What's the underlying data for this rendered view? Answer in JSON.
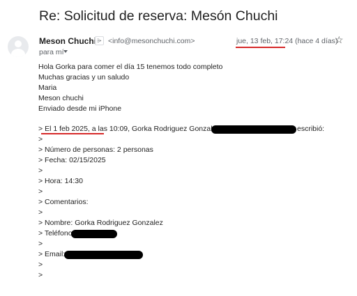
{
  "email": {
    "subject": "Re: Solicitud de reserva: Mesón Chuchi",
    "sender_name": "Meson Chuchi",
    "sender_email": "<info@mesonchuchi.com>",
    "to_me": "para mí",
    "date": "jue, 13 feb, 17:24",
    "relative_date": " (hace 4 días)",
    "body_lines": [
      "Hola Gorka para comer el día 15 tenemos todo completo",
      "Muchas gracias y un saludo",
      "Maria",
      "Meson chuchi",
      "Enviado desde mi iPhone"
    ],
    "quote": {
      "prefix": "> ",
      "date_text": "El 1 feb 2025, a las 10:09",
      "author_text": ", Gorka Rodriguez Gonzalez",
      "wrote_text": "escribió:",
      "lines": [
        ">",
        "> Número de personas: 2 personas",
        "> Fecha: 02/15/2025",
        ">",
        "> Hora: 14:30",
        ">",
        "> Comentarios:",
        ">",
        "> Nombre: Gorka Rodriguez Gonzalez",
        "> Teléfono:",
        ">",
        "> Email:",
        ">",
        ">"
      ]
    }
  },
  "icons": {
    "star": "☆",
    "badge": "⩥"
  },
  "colors": {
    "annotation_red": "#d62828",
    "redaction": "#000000",
    "meta_gray": "#5f6368"
  }
}
